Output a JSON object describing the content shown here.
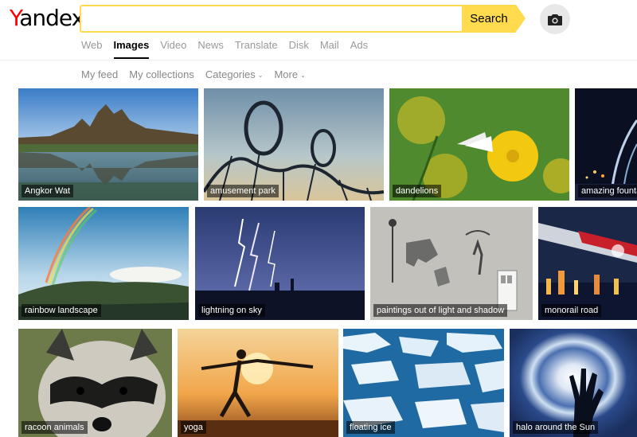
{
  "logo": {
    "first": "Y",
    "rest": "andex"
  },
  "search": {
    "value": "",
    "button_label": "Search"
  },
  "services": [
    "Web",
    "Images",
    "Video",
    "News",
    "Translate",
    "Disk",
    "Mail",
    "Ads"
  ],
  "subnav": {
    "feed": "My feed",
    "collections": "My collections",
    "categories": "Categories",
    "more": "More"
  },
  "images": [
    {
      "caption": "Angkor Wat"
    },
    {
      "caption": "amusement park"
    },
    {
      "caption": "dandelions"
    },
    {
      "caption": "amazing founta"
    },
    {
      "caption": "rainbow landscape"
    },
    {
      "caption": "lightning on sky"
    },
    {
      "caption": "paintings out of light and shadow"
    },
    {
      "caption": "monorail road"
    },
    {
      "caption": "racoon animals"
    },
    {
      "caption": "yoga"
    },
    {
      "caption": "floating ice"
    },
    {
      "caption": "halo around the Sun"
    }
  ]
}
